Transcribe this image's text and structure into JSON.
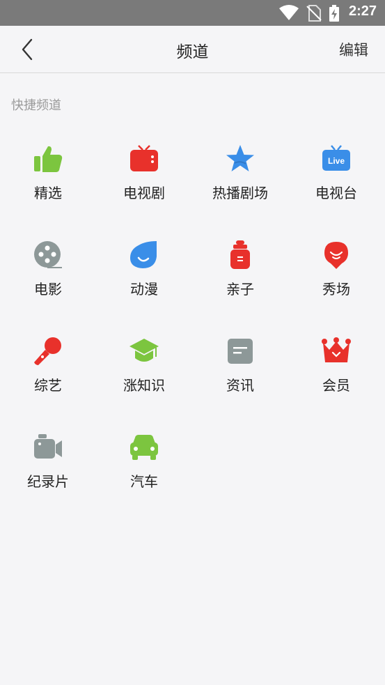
{
  "status_bar": {
    "time": "2:27",
    "icons": [
      "wifi-icon",
      "no-sim-icon",
      "battery-charging-icon"
    ]
  },
  "header": {
    "title": "频道",
    "back_icon": "chevron-left-icon",
    "edit_label": "编辑"
  },
  "section": {
    "label": "快捷频道"
  },
  "channels": [
    {
      "label": "精选",
      "icon": "thumbs-up-icon",
      "color": "#7cc53f"
    },
    {
      "label": "电视剧",
      "icon": "tv-icon",
      "color": "#e8312b"
    },
    {
      "label": "热播剧场",
      "icon": "star-icon",
      "color": "#3a8ee8"
    },
    {
      "label": "电视台",
      "icon": "live-tv-icon",
      "color": "#3a8ee8"
    },
    {
      "label": "电影",
      "icon": "film-reel-icon",
      "color": "#8d9898"
    },
    {
      "label": "动漫",
      "icon": "anime-face-icon",
      "color": "#3a8ee8"
    },
    {
      "label": "亲子",
      "icon": "baby-bottle-icon",
      "color": "#e8312b"
    },
    {
      "label": "秀场",
      "icon": "smile-pin-icon",
      "color": "#e8312b"
    },
    {
      "label": "综艺",
      "icon": "microphone-icon",
      "color": "#e8312b"
    },
    {
      "label": "涨知识",
      "icon": "graduation-cap-icon",
      "color": "#7cc53f"
    },
    {
      "label": "资讯",
      "icon": "news-icon",
      "color": "#8d9898"
    },
    {
      "label": "会员",
      "icon": "crown-icon",
      "color": "#e8312b"
    },
    {
      "label": "纪录片",
      "icon": "video-camera-icon",
      "color": "#8d9898"
    },
    {
      "label": "汽车",
      "icon": "car-icon",
      "color": "#7cc53f"
    }
  ]
}
